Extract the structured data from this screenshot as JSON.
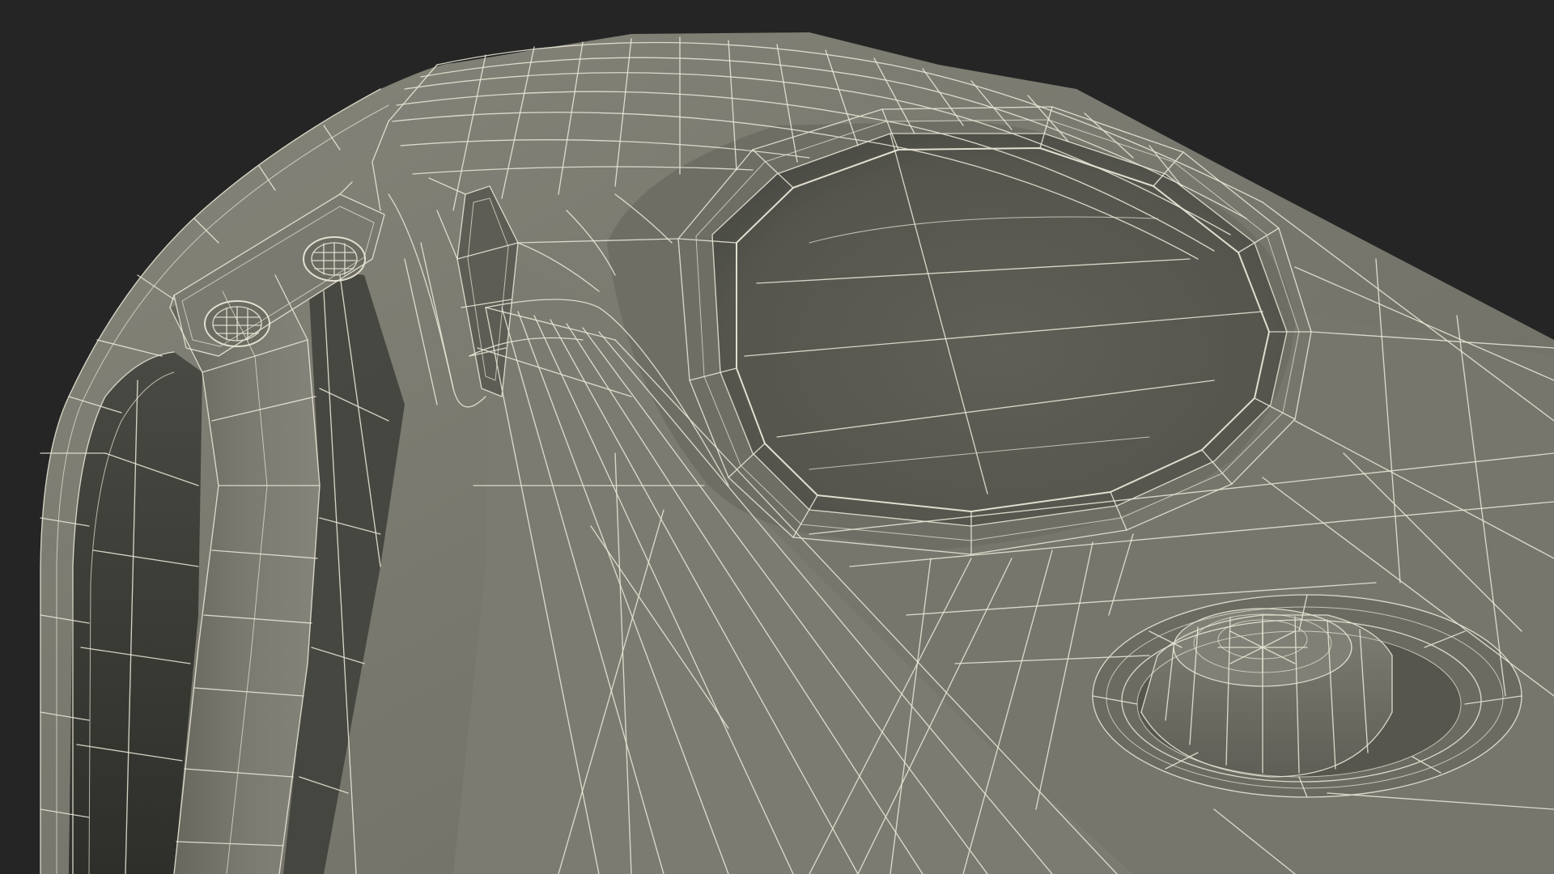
{
  "scene": {
    "subject": "wireframe-3d-model-render",
    "colors": {
      "background": "#252525",
      "surface_light": "#7d7d72",
      "surface_mid": "#6f6f65",
      "surface_dark": "#3a3a35",
      "cavity": "#595951",
      "wire": "#e9e6d6"
    }
  }
}
